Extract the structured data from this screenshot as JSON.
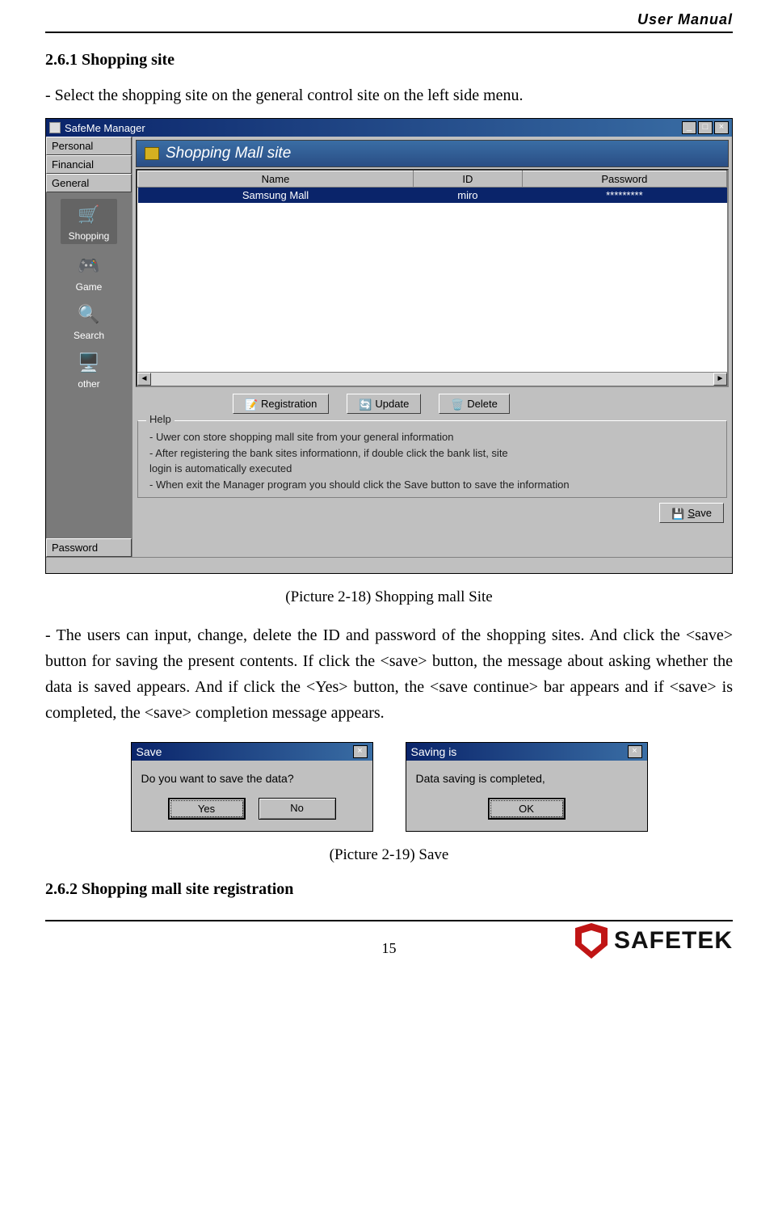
{
  "header": {
    "title": "User Manual"
  },
  "section": {
    "heading_261": "2.6.1 Shopping site",
    "intro_261": "- Select the shopping site on the general control site on the left side menu.",
    "caption_218": "(Picture 2-18) Shopping mall Site",
    "body_261": "- The users can input, change, delete the ID and password of the shopping sites. And click the <save> button for saving the present contents.    If click the <save> button, the message about asking whether the data is saved appears. And if click the <Yes> button, the <save continue> bar appears and if <save> is completed, the <save> completion message appears.",
    "caption_219": "(Picture 2-19) Save",
    "heading_262": "2.6.2 Shopping mall site registration"
  },
  "app": {
    "title": "SafeMe Manager",
    "winbtns": {
      "min": "_",
      "max": "□",
      "close": "×"
    },
    "sidebar": {
      "top_tabs": [
        "Personal",
        "Financial",
        "General"
      ],
      "items": [
        {
          "label": "Shopping",
          "icon": "🛒",
          "selected": true
        },
        {
          "label": "Game",
          "icon": "🎮",
          "selected": false
        },
        {
          "label": "Search",
          "icon": "🔍",
          "selected": false
        },
        {
          "label": "other",
          "icon": "🖥️",
          "selected": false
        }
      ],
      "bottom_tab": "Password"
    },
    "panel": {
      "title": "Shopping Mall site",
      "columns": [
        "Name",
        "ID",
        "Password"
      ],
      "rows": [
        {
          "name": "Samsung Mall",
          "id": "miro",
          "password": "*********",
          "selected": true
        }
      ],
      "actions": {
        "registration": "Registration",
        "update": "Update",
        "delete": "Delete"
      },
      "help": {
        "legend": "Help",
        "line1": "- Uwer con store shopping mall site from your general information",
        "line2": "- After registering the bank sites informationn, if double click the bank list, site",
        "line3": "  login is automatically executed",
        "line4": "- When exit the Manager program you should click the Save button to save the information"
      },
      "save": "Save"
    }
  },
  "dialogs": {
    "save": {
      "title": "Save",
      "message": "Do you want to save the data?",
      "yes": "Yes",
      "no": "No"
    },
    "done": {
      "title": "Saving is",
      "message": "Data saving is completed,",
      "ok": "OK"
    }
  },
  "footer": {
    "page": "15",
    "brand": "SAFETEK"
  }
}
